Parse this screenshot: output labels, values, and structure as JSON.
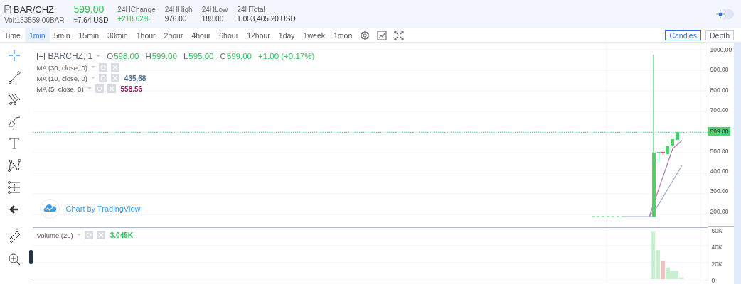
{
  "pair": {
    "symbol": "BAR/CHZ",
    "volume": "Vol:153559.00BAR",
    "price": "599.00",
    "price_usd": "≈7.64 USD"
  },
  "stats": [
    {
      "label": "24HChange",
      "value": "+218.62%",
      "kind": "up"
    },
    {
      "label": "24HHigh",
      "value": "976.00",
      "kind": "plain"
    },
    {
      "label": "24HLow",
      "value": "188.00",
      "kind": "plain"
    },
    {
      "label": "24HTotal",
      "value": "1,003,405.20 USD",
      "kind": "plain"
    }
  ],
  "intervals": [
    {
      "label": "Time",
      "selected": false
    },
    {
      "label": "1min",
      "selected": true
    },
    {
      "label": "5min",
      "selected": false
    },
    {
      "label": "15min",
      "selected": false
    },
    {
      "label": "30min",
      "selected": false
    },
    {
      "label": "1hour",
      "selected": false
    },
    {
      "label": "2hour",
      "selected": false
    },
    {
      "label": "4hour",
      "selected": false
    },
    {
      "label": "6hour",
      "selected": false
    },
    {
      "label": "12hour",
      "selected": false
    },
    {
      "label": "1day",
      "selected": false
    },
    {
      "label": "1week",
      "selected": false
    },
    {
      "label": "1mon",
      "selected": false
    }
  ],
  "theme_toggle": {
    "on": false
  },
  "view_buttons": [
    {
      "label": "Candles",
      "selected": true
    },
    {
      "label": "Depth",
      "selected": false
    }
  ],
  "chart": {
    "title": "BARCHZ, 1",
    "ohlc": [
      {
        "key": "O",
        "value": "598.00"
      },
      {
        "key": "H",
        "value": "599.00"
      },
      {
        "key": "L",
        "value": "595.00"
      },
      {
        "key": "C",
        "value": "599.00"
      }
    ],
    "change": "+1.00 (+0.17%)",
    "indicators": [
      {
        "label": "MA (30, close, 0)"
      },
      {
        "label": "MA (10, close, 0)",
        "value": "435.68",
        "color": "#4e6a8f"
      },
      {
        "label": "MA (5, close, 0)",
        "value": "558.56",
        "color": "#8e1c5e"
      }
    ],
    "branding": "Chart by TradingView",
    "price_axis": [
      "1000.00",
      "900.00",
      "800.00",
      "700.00",
      "500.00",
      "400.00",
      "300.00",
      "200.00"
    ],
    "last_price": "599.00",
    "volume_indicator": {
      "label": "Volume (20)",
      "value": "3.045K"
    },
    "volume_axis": [
      "60K",
      "40K",
      "20K",
      "0"
    ]
  }
}
